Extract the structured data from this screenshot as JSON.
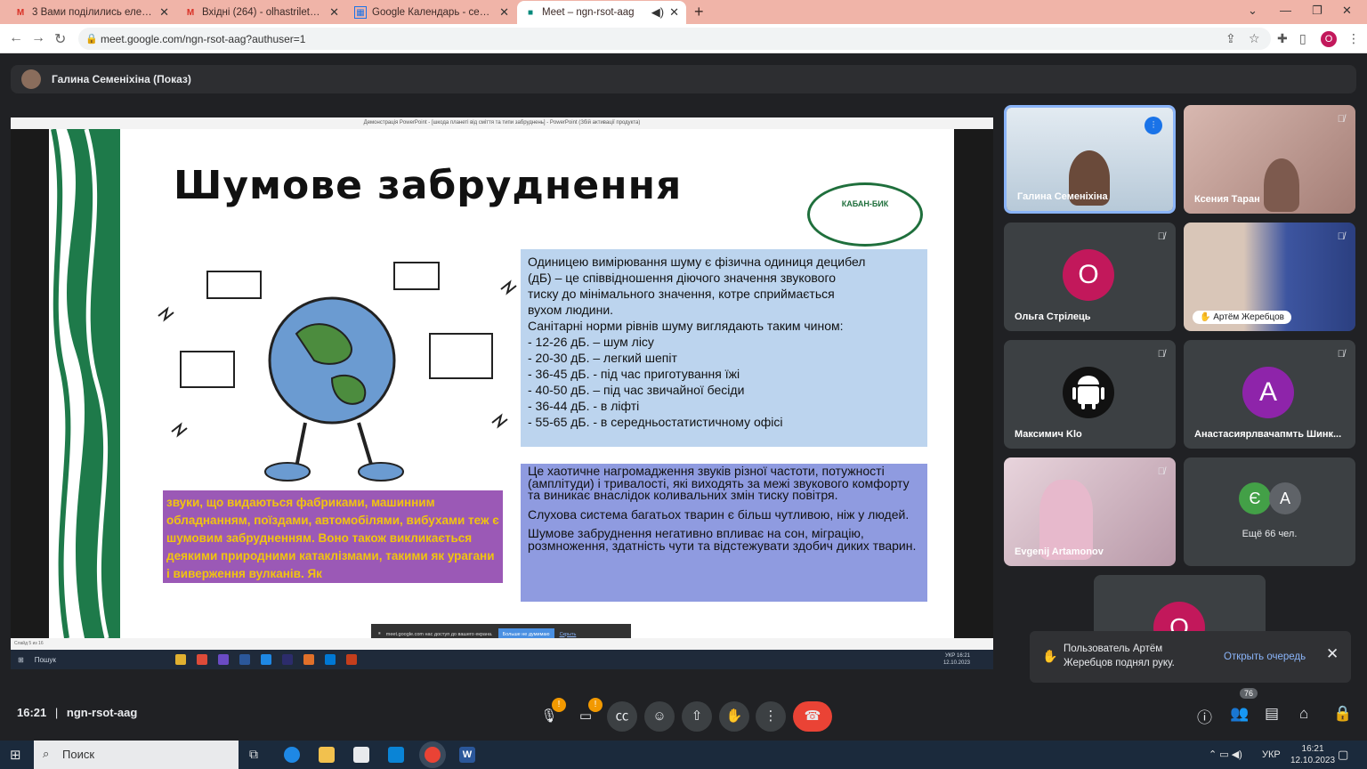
{
  "browser": {
    "tabs": [
      {
        "title": "3 Вами поділились електронною",
        "icon": "gmail-icon"
      },
      {
        "title": "Вхідні (264) - olhastrilets20@gm",
        "icon": "gmail-icon"
      },
      {
        "title": "Google Календарь - сентябрь 2",
        "icon": "calendar-icon"
      },
      {
        "title": "Meet – ngn-rsot-aag",
        "icon": "meet-icon"
      }
    ],
    "url": "meet.google.com/ngn-rsot-aag?authuser=1",
    "profile_letter": "O"
  },
  "presenter": {
    "label": "Галина Семеніхіна (Показ)"
  },
  "shared": {
    "window_title": "Демонстрація PowerPoint - [шкода планеті від сміття та типи забруднень] - PowerPoint (Збій активації продукта)",
    "slide": {
      "title": "Шумове забруднення",
      "logo_text": "КАБАН-БИК",
      "box1_lines": [
        "Одиницею вимірювання шуму є фізична одиниця децибел",
        "(дБ) – це співвідношення діючого значення звукового",
        "тиску до мінімального значення, котре сприймається",
        "вухом людини.",
        "Санітарні норми рівнів шуму виглядають таким чином:",
        "- 12-26 дБ. – шум лісу",
        "- 20-30 дБ. – легкий шепіт",
        "- 36-45 дБ. - під час приготування їжі",
        "- 40-50 дБ. – під час звичайної бесіди",
        "- 36-44 дБ. - в ліфті",
        "- 55-65 дБ. - в середньостатистичному офісі"
      ],
      "box2_paragraphs": [
        "Це хаотичне нагромадження звуків різної частоти, потужності (амплітуди) і тривалості, які виходять за межі звукового комфорту та виникає внаслідок коливальних змін тиску повітря.",
        "Слухова система багатьох тварин є більш чутливою, ніж у людей.",
        "Шумове забруднення негативно впливає на сон, міграцію, розмноження, здатність чути та відстежувати здобич диких тварин."
      ],
      "box3": "звуки, що видаються фабриками, машинним обладнанням, поїздами, автомобілями, вибухами теж є шумовим забрудненням. Воно також викликається деякими природними катаклізмами, такими як урагани і виверження вулканів. Як"
    },
    "notice": {
      "text": "meet.google.com нас доступ до вашего екрана.",
      "button": "Больше не думимаю",
      "link": "Скрыть"
    },
    "status": "Слайд 5 из 16",
    "taskbar": {
      "search": "Пошук",
      "lang": "УКР",
      "time": "16:21",
      "date": "12.10.2023"
    }
  },
  "participants": [
    {
      "name": "Галина Семеніхіна",
      "type": "video",
      "mic": "speaking",
      "bg": "#b7c9d8"
    },
    {
      "name": "Ксения Таран",
      "type": "video",
      "mic": "muted",
      "bg": "#c4a19a"
    },
    {
      "name": "Ольга Стрілець",
      "type": "avatar",
      "letter": "O",
      "avatar_color": "#c2185b",
      "mic": "muted"
    },
    {
      "name": "Артём Жеребцов",
      "type": "video",
      "mic": "muted",
      "hand": true,
      "bg": "#4a5a8c"
    },
    {
      "name": "Максимич Klo",
      "type": "android",
      "mic": "muted"
    },
    {
      "name": "Анастасиярлвачапмть Шинк...",
      "type": "avatar",
      "letter": "A",
      "avatar_color": "#8e24aa",
      "mic": "muted"
    },
    {
      "name": "Evgenij Artamonov",
      "type": "video",
      "mic": "muted",
      "bg": "#c9b0c0"
    },
    {
      "name": "Ещё 66 чел.",
      "type": "more",
      "letters": [
        "Є",
        "A"
      ],
      "colors": [
        "#43a047",
        "#5f6368"
      ]
    }
  ],
  "partial_tile": {
    "letter": "O",
    "color": "#c2185b"
  },
  "toast": {
    "line1": "Пользователь Артём",
    "line2": "Жеребцов поднял руку.",
    "action": "Открыть очередь"
  },
  "bottom": {
    "time": "16:21",
    "separator": "|",
    "meeting_code": "ngn-rsot-aag",
    "people_count": "76"
  },
  "windows_taskbar": {
    "search": "Поиск",
    "lang": "УКР",
    "time": "16:21",
    "date": "12.10.2023"
  }
}
